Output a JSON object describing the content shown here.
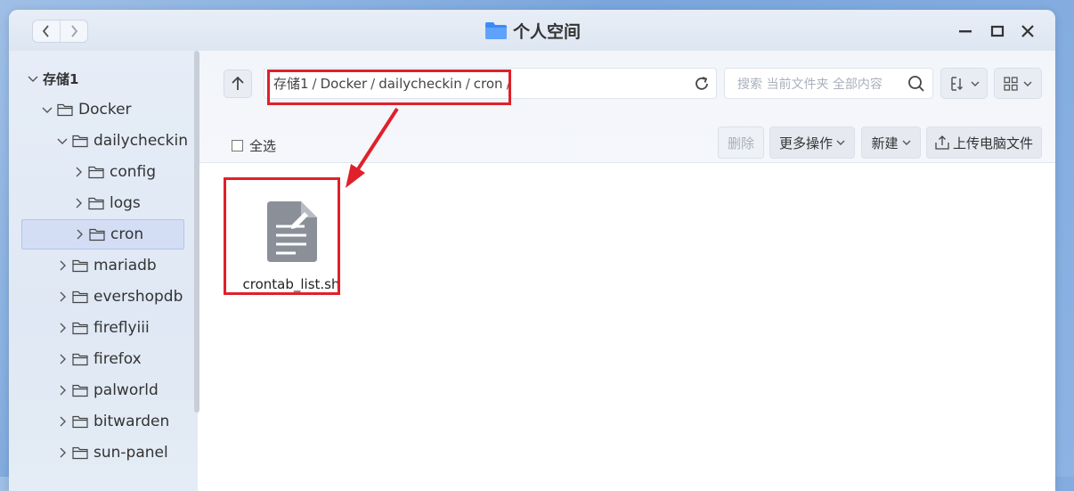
{
  "window": {
    "title": "个人空间",
    "controls": {
      "minimize": "minimize-icon",
      "maximize": "maximize-icon",
      "close": "close-icon"
    }
  },
  "sidebar": {
    "items": [
      {
        "label": "存储1",
        "expanded": true,
        "folder": false
      },
      {
        "label": "Docker",
        "expanded": true,
        "folder": true
      },
      {
        "label": "dailycheckin",
        "expanded": true,
        "folder": true
      },
      {
        "label": "config",
        "expanded": false,
        "folder": true
      },
      {
        "label": "logs",
        "expanded": false,
        "folder": true
      },
      {
        "label": "cron",
        "expanded": false,
        "folder": true,
        "selected": true
      },
      {
        "label": "mariadb",
        "expanded": false,
        "folder": true
      },
      {
        "label": "evershopdb",
        "expanded": false,
        "folder": true
      },
      {
        "label": "fireflyiii",
        "expanded": false,
        "folder": true
      },
      {
        "label": "firefox",
        "expanded": false,
        "folder": true
      },
      {
        "label": "palworld",
        "expanded": false,
        "folder": true
      },
      {
        "label": "bitwarden",
        "expanded": false,
        "folder": true
      },
      {
        "label": "sun-panel",
        "expanded": false,
        "folder": true
      }
    ]
  },
  "path": {
    "crumbs": [
      "存储1",
      "Docker",
      "dailycheckin",
      "cron"
    ],
    "separator": "/"
  },
  "search": {
    "placeholder": "搜索 当前文件夹 全部内容"
  },
  "toolbar": {
    "select_all": "全选",
    "delete": "删除",
    "more_actions": "更多操作",
    "new": "新建",
    "upload": "上传电脑文件"
  },
  "files": [
    {
      "name": "crontab_list.sh",
      "icon": "text-file-icon"
    }
  ],
  "colors": {
    "accent_folder": "#3d8af7",
    "highlight": "#e0202a",
    "selected_bg": "#d3def5"
  }
}
